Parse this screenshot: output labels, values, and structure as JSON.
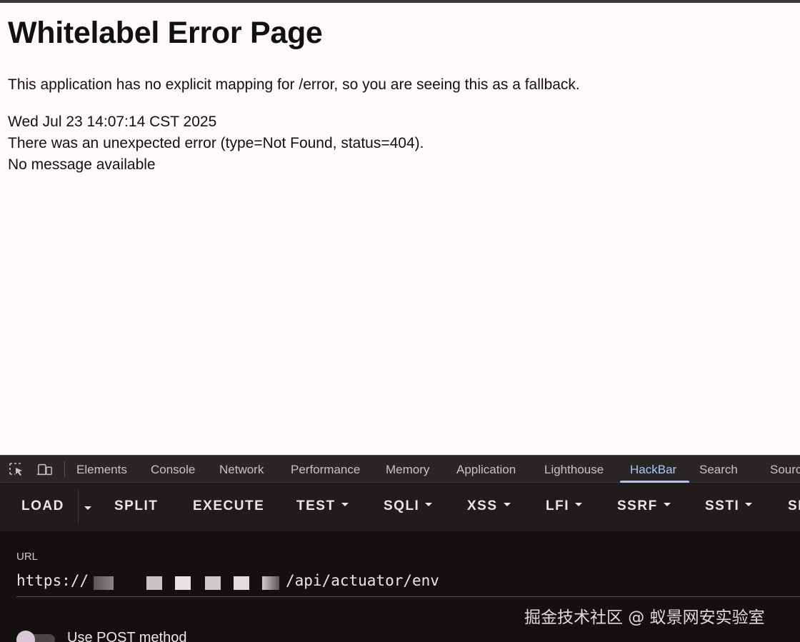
{
  "page": {
    "title": "Whitelabel Error Page",
    "line1": "This application has no explicit mapping for /error, so you are seeing this as a fallback.",
    "timestamp": "Wed Jul 23 14:07:14 CST 2025",
    "error_line": "There was an unexpected error (type=Not Found, status=404).",
    "message": "No message available"
  },
  "devtools": {
    "icons": [
      "inspect-element-icon",
      "device-toolbar-icon"
    ],
    "tabs": [
      "Elements",
      "Console",
      "Network",
      "Performance",
      "Memory",
      "Application",
      "Lighthouse",
      "HackBar",
      "Search",
      "Sources"
    ],
    "active_tab": "HackBar",
    "accent_color": "#a8c7fa"
  },
  "hackbar": {
    "buttons": [
      "LOAD",
      "SPLIT",
      "EXECUTE",
      "TEST",
      "SQLI",
      "XSS",
      "LFI",
      "SSRF",
      "SSTI",
      "SHELL"
    ],
    "url_label": "URL",
    "url_prefix": "https://",
    "url_suffix": "/api/actuator/env",
    "post_label": "Use POST method",
    "post_enabled": false
  },
  "watermark": "掘金技术社区 @ 蚁景网安实验室"
}
